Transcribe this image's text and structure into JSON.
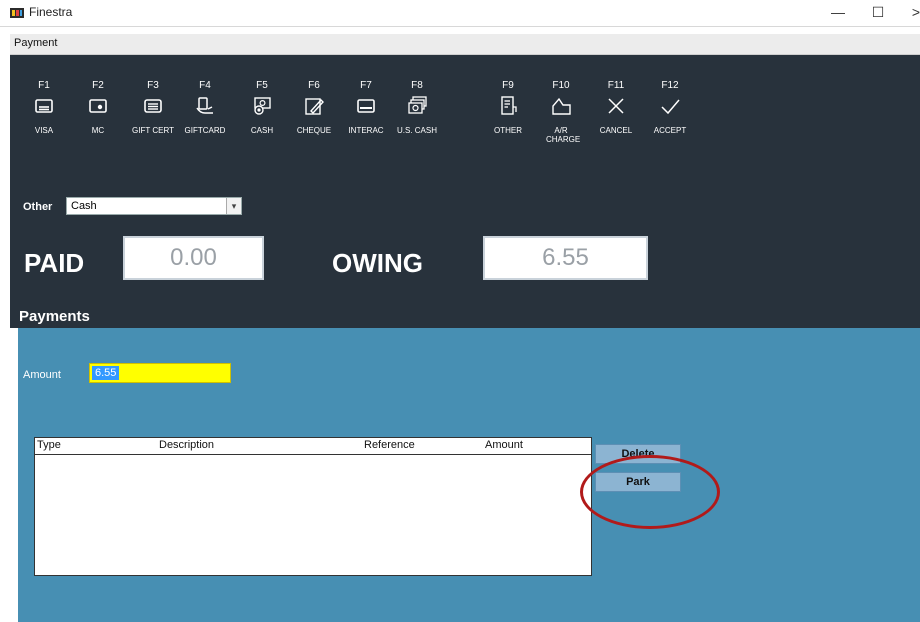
{
  "window": {
    "title": "Finestra",
    "controls": {
      "minimize": "—",
      "maximize": "☐",
      "close": ">"
    }
  },
  "menu": {
    "items": [
      {
        "label": "Payment"
      }
    ]
  },
  "tender_buttons": [
    {
      "key": "F1",
      "label": "VISA",
      "icon": "credit-card-icon"
    },
    {
      "key": "F2",
      "label": "MC",
      "icon": "card-chip-icon"
    },
    {
      "key": "F3",
      "label": "GIFT CERT",
      "icon": "receipt-icon"
    },
    {
      "key": "F4",
      "label": "GIFTCARD",
      "icon": "hand-card-icon"
    },
    {
      "key": "F5",
      "label": "CASH",
      "icon": "cash-icon"
    },
    {
      "key": "F6",
      "label": "CHEQUE",
      "icon": "pen-icon"
    },
    {
      "key": "F7",
      "label": "INTERAC",
      "icon": "debit-card-icon"
    },
    {
      "key": "F8",
      "label": "U.S. CASH",
      "icon": "bills-stack-icon"
    },
    {
      "key": "F9",
      "label": "OTHER",
      "icon": "document-icon"
    },
    {
      "key": "F10",
      "label": "A/R CHARGE",
      "icon": "hand-tag-icon"
    },
    {
      "key": "F11",
      "label": "CANCEL",
      "icon": "x-icon"
    },
    {
      "key": "F12",
      "label": "ACCEPT",
      "icon": "check-icon"
    }
  ],
  "other": {
    "label": "Other",
    "selected": "Cash"
  },
  "totals": {
    "paid_label": "PAID",
    "paid_value": "0.00",
    "owing_label": "OWING",
    "owing_value": "6.55"
  },
  "payments": {
    "title": "Payments",
    "amount_label": "Amount",
    "amount_value": "6.55",
    "columns": [
      "Type",
      "Description",
      "Reference",
      "Amount"
    ],
    "rows": [],
    "delete_label": "Delete",
    "park_label": "Park"
  },
  "colors": {
    "dark_panel": "#28323c",
    "payments_panel": "#478fb3",
    "amount_highlight": "#ffff00",
    "annotation": "#b11a1a"
  }
}
